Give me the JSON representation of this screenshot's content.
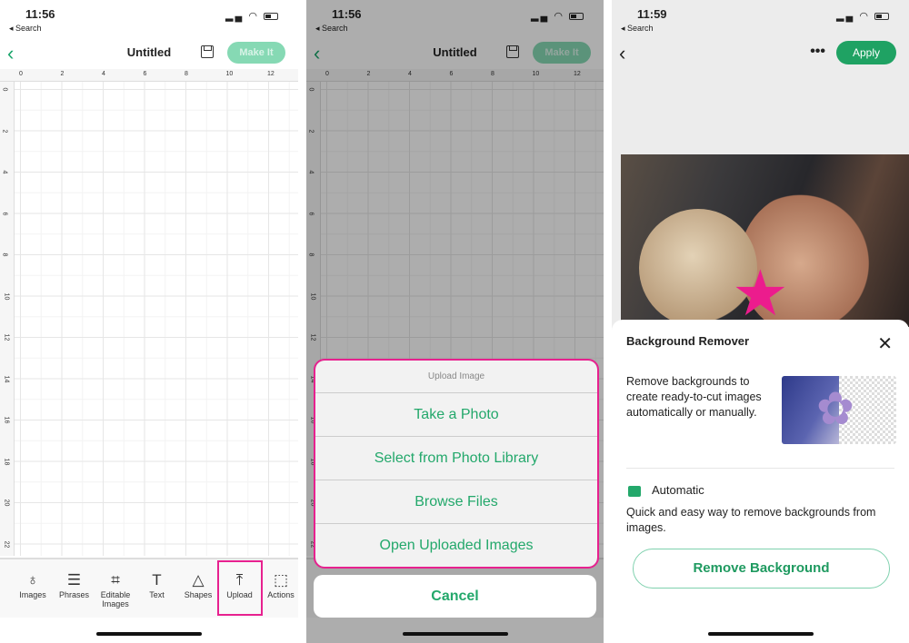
{
  "colors": {
    "accent": "#23a86b",
    "highlight": "#e7218f"
  },
  "screen1": {
    "time": "11:56",
    "back_app": "◂ Search",
    "title": "Untitled",
    "make_it": "Make It",
    "ruler_top": [
      "0",
      "2",
      "4",
      "6",
      "8",
      "10",
      "12"
    ],
    "ruler_left": [
      "0",
      "2",
      "4",
      "6",
      "8",
      "10",
      "12",
      "14",
      "16",
      "18",
      "20",
      "22"
    ],
    "tools": [
      {
        "label": "Images",
        "icon": "balloon-icon",
        "glyph": "♁"
      },
      {
        "label": "Phrases",
        "icon": "speech-bubble-icon",
        "glyph": "☰"
      },
      {
        "label": "Editable Images",
        "icon": "editable-image-icon",
        "glyph": "⌗"
      },
      {
        "label": "Text",
        "icon": "text-icon",
        "glyph": "T"
      },
      {
        "label": "Shapes",
        "icon": "shapes-icon",
        "glyph": "△"
      },
      {
        "label": "Upload",
        "icon": "upload-icon",
        "glyph": "⤒"
      },
      {
        "label": "Actions",
        "icon": "actions-icon",
        "glyph": "⬚"
      }
    ]
  },
  "screen2": {
    "time": "11:56",
    "back_app": "◂ Search",
    "title": "Untitled",
    "make_it": "Make It",
    "sheet_title": "Upload Image",
    "options": [
      "Take a Photo",
      "Select from Photo Library",
      "Browse Files",
      "Open Uploaded Images"
    ],
    "cancel": "Cancel"
  },
  "screen3": {
    "time": "11:59",
    "back_app": "◂ Search",
    "apply": "Apply",
    "more": "•••",
    "sheet_title": "Background Remover",
    "description": "Remove backgrounds to create ready-to-cut images automatically or manually.",
    "option_title": "Automatic",
    "option_desc": "Quick and easy way to remove backgrounds from images.",
    "button": "Remove Background"
  }
}
